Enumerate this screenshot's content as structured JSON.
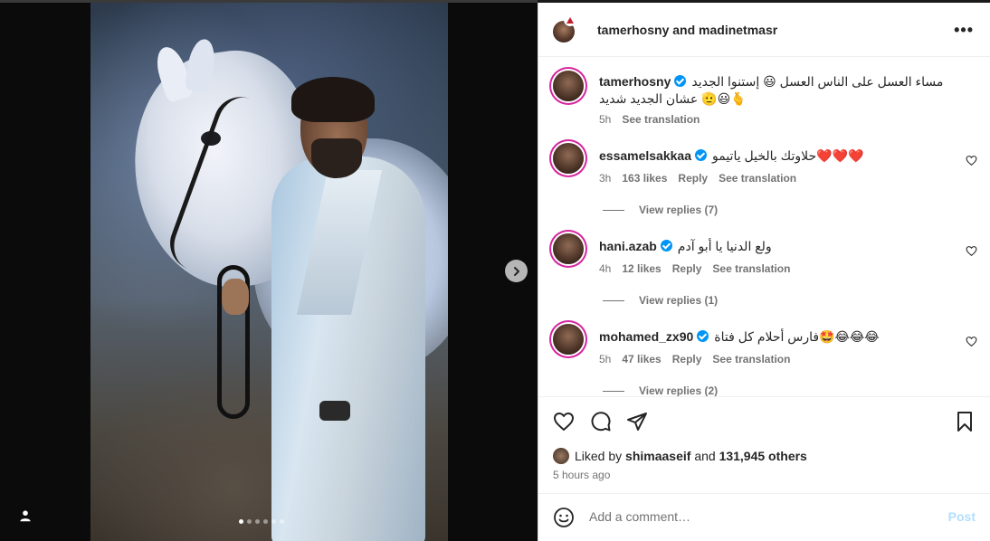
{
  "header": {
    "title": "tamerhosny and madinetmasr"
  },
  "caption": {
    "user": "tamerhosny",
    "line1": "مساء العسل على الناس العسل 😃 إستنوا الجديد",
    "line2": "عشان الجديد شديد 🫡😃🫰",
    "time": "5h",
    "see_translation": "See translation"
  },
  "comments": [
    {
      "user": "essamelsakkaa",
      "text": "حلاوتك بالخيل ياتيمو❤️❤️❤️",
      "time": "3h",
      "likes": "163 likes",
      "reply": "Reply",
      "see_translation": "See translation",
      "view_replies": "View replies (7)"
    },
    {
      "user": "hani.azab",
      "text": "ولع الدنيا يا أبو آدم",
      "time": "4h",
      "likes": "12 likes",
      "reply": "Reply",
      "see_translation": "See translation",
      "view_replies": "View replies (1)"
    },
    {
      "user": "mohamed_zx90",
      "text": "فارس أحلام كل فتاة🤩😂😂😂",
      "time": "5h",
      "likes": "47 likes",
      "reply": "Reply",
      "see_translation": "See translation",
      "view_replies": "View replies (2)"
    }
  ],
  "likes": {
    "prefix": "Liked by",
    "user": "shimaaseif",
    "and": "and",
    "others": "131,945 others"
  },
  "post_time": "5 hours ago",
  "comment_input": {
    "placeholder": "Add a comment…"
  },
  "post_label": "Post",
  "carousel": {
    "total": 6,
    "active": 1
  },
  "colors": {
    "verified": "#0095f6",
    "story_ring": "#d6249f",
    "post_disabled": "#b2dffc"
  }
}
